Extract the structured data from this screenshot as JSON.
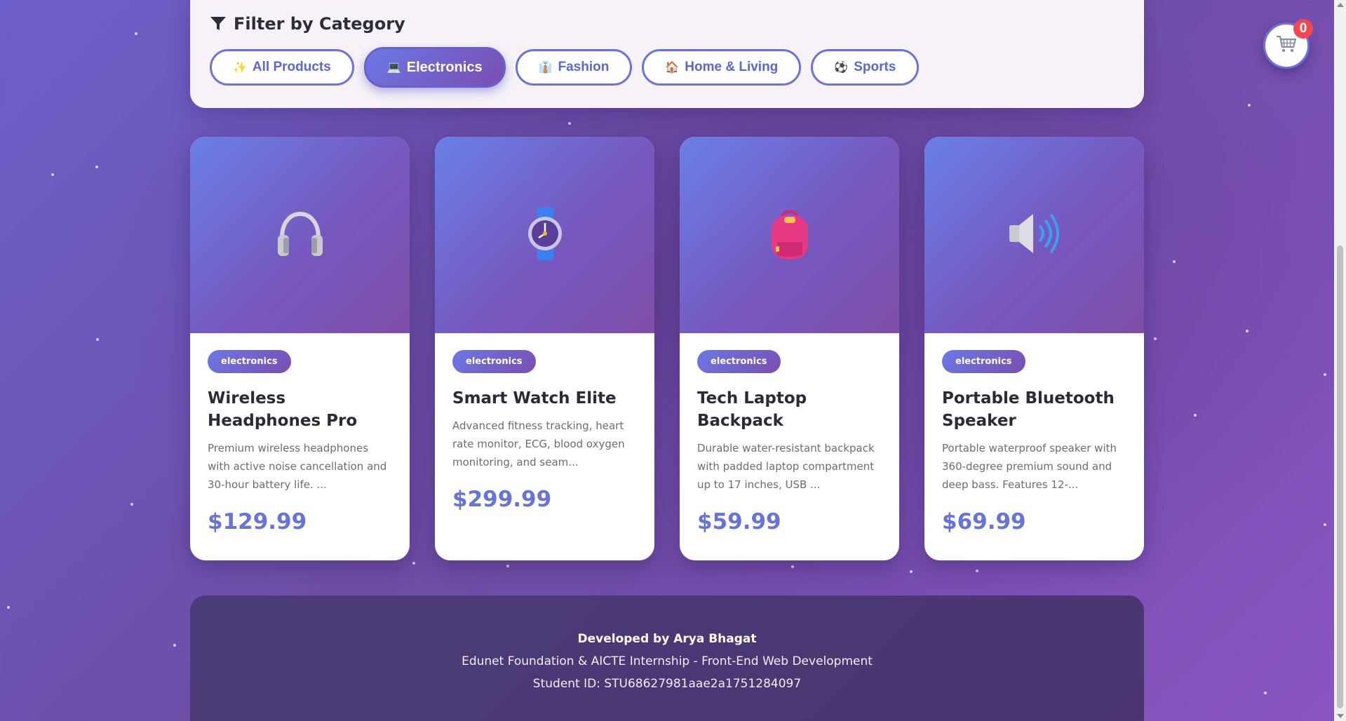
{
  "filter": {
    "title": "Filter by Category",
    "categories": [
      {
        "icon": "✨",
        "label": "All Products",
        "active": false
      },
      {
        "icon": "💻",
        "label": "Electronics",
        "active": true
      },
      {
        "icon": "👔",
        "label": "Fashion",
        "active": false
      },
      {
        "icon": "🏠",
        "label": "Home & Living",
        "active": false
      },
      {
        "icon": "⚽",
        "label": "Sports",
        "active": false
      }
    ]
  },
  "cart": {
    "count": "0",
    "icon": "cart-icon"
  },
  "products": [
    {
      "icon": "headphones-icon",
      "category": "electronics",
      "name": "Wireless Headphones Pro",
      "description": "Premium wireless headphones with active noise cancellation and 30-hour battery life. ...",
      "price": "$129.99"
    },
    {
      "icon": "watch-icon",
      "category": "electronics",
      "name": "Smart Watch Elite",
      "description": "Advanced fitness tracking, heart rate monitor, ECG, blood oxygen monitoring, and seam...",
      "price": "$299.99"
    },
    {
      "icon": "backpack-icon",
      "category": "electronics",
      "name": "Tech Laptop Backpack",
      "description": "Durable water-resistant backpack with padded laptop compartment up to 17 inches, USB ...",
      "price": "$59.99"
    },
    {
      "icon": "speaker-icon",
      "category": "electronics",
      "name": "Portable Bluetooth Speaker",
      "description": "Portable waterproof speaker with 360-degree premium sound and deep bass. Features 12-...",
      "price": "$69.99"
    }
  ],
  "footer": {
    "developer": "Developed by Arya Bhagat",
    "program": "Edunet Foundation & AICTE Internship - Front-End Web Development",
    "student_id": "Student ID: STU68627981aae2a1751284097"
  },
  "colors": {
    "accent": "#6673d8",
    "badge_red": "#f0494f",
    "gradient_start": "#6b78e6",
    "gradient_end": "#7a4eb0"
  }
}
